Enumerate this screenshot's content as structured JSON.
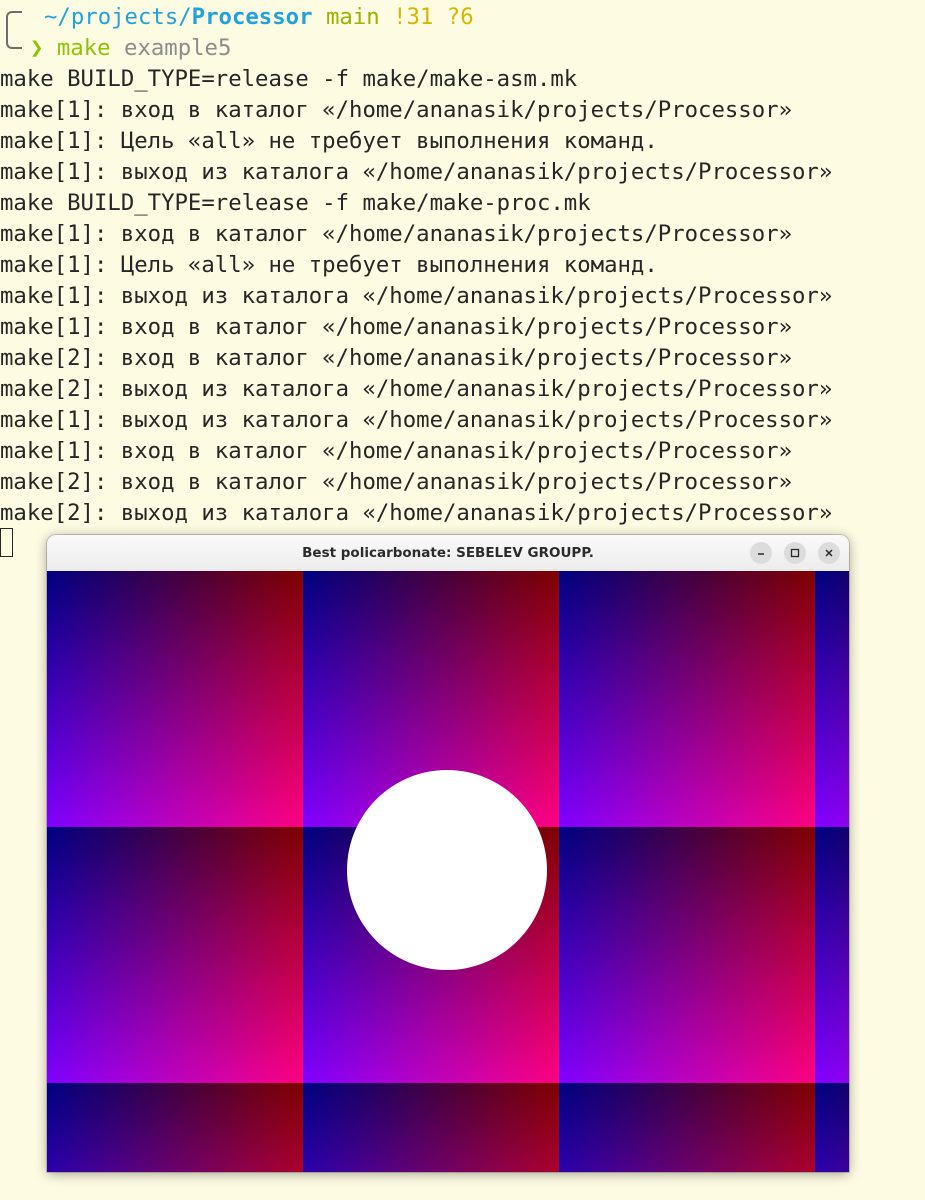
{
  "prompt": {
    "path_prefix": "~/projects/",
    "path_dir": "Processor",
    "branch": "main",
    "status": "!31 ?6",
    "arrow": "❯",
    "command": "make",
    "argument": "example5"
  },
  "output_lines": [
    "make BUILD_TYPE=release -f make/make-asm.mk",
    "make[1]: вход в каталог «/home/ananasik/projects/Processor»",
    "make[1]: Цель «all» не требует выполнения команд.",
    "make[1]: выход из каталога «/home/ananasik/projects/Processor»",
    "make BUILD_TYPE=release -f make/make-proc.mk",
    "make[1]: вход в каталог «/home/ananasik/projects/Processor»",
    "make[1]: Цель «all» не требует выполнения команд.",
    "make[1]: выход из каталога «/home/ananasik/projects/Processor»",
    "make[1]: вход в каталог «/home/ananasik/projects/Processor»",
    "make[2]: вход в каталог «/home/ananasik/projects/Processor»",
    "make[2]: выход из каталога «/home/ananasik/projects/Processor»",
    "make[1]: выход из каталога «/home/ananasik/projects/Processor»",
    "make[1]: вход в каталог «/home/ananasik/projects/Processor»",
    "make[2]: вход в каталог «/home/ananasik/projects/Processor»",
    "make[2]: выход из каталога «/home/ananasik/projects/Processor»"
  ],
  "window": {
    "title": "Best policarbonate: SEBELEV GROUPP.",
    "controls": [
      "minimize-icon",
      "maximize-icon",
      "close-icon"
    ]
  },
  "colors": {
    "terminal_bg": "#fdfbe2",
    "terminal_fg": "#262626",
    "path": "#22a1dc",
    "branch": "#96b300",
    "status": "#d8b600",
    "command": "#8cc400",
    "argument": "#8c8c8c",
    "pattern_black": "#000000",
    "pattern_red": "#ff0000",
    "pattern_blue": "#0000ff",
    "pattern_magenta": "#ff00ff",
    "circle": "#ffffff"
  }
}
